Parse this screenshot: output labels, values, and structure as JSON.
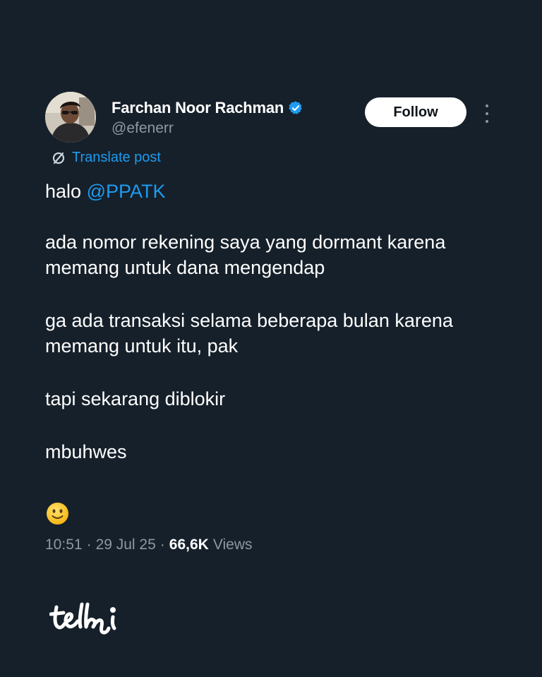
{
  "author": {
    "display_name": "Farchan Noor Rachman",
    "handle": "@efenerr",
    "verified_icon": "verified-badge-icon"
  },
  "actions": {
    "follow_label": "Follow",
    "more_icon": "more-vertical-icon"
  },
  "translate": {
    "label": "Translate post",
    "icon": "translate-globe-icon"
  },
  "post": {
    "greeting": "halo ",
    "mention": "@PPATK",
    "paragraphs": [
      "ada nomor rekening saya yang dormant karena memang untuk dana mengendap",
      "ga ada transaksi selama beberapa bulan karena memang untuk itu, pak",
      "tapi sekarang diblokir",
      "mbuhwes"
    ],
    "emoji": "slightly-smiling-face-emoji"
  },
  "meta": {
    "time": "10:51",
    "separator": "·",
    "date": "29 Jul 25",
    "views_count": "66,6K",
    "views_label": "Views"
  },
  "colors": {
    "background": "#16202a",
    "accent": "#1d9bf0",
    "secondary_text": "#8b98a5",
    "verified": "#1d9bf0"
  }
}
